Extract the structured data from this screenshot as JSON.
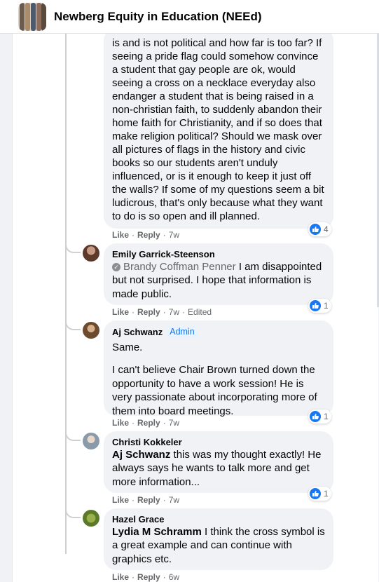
{
  "header": {
    "group_name": "Newberg Equity in Education (NEEd)"
  },
  "comments": [
    {
      "lines": [
        "is and is not political and how far is too far? If",
        "seeing a pride flag could somehow convince",
        "a student that gay people are ok, would",
        "seeing a cross on a necklace everyday also",
        "endanger a student that is being raised in a",
        "non-christian faith, to suddenly abandon their",
        "home faith for Christianity, and if so does that",
        "make religion political? Should we mask over",
        "all pictures of flags in the history and civic",
        "books so our students aren't unduly",
        "influenced, or is it enough to keep it just off",
        "the walls? If some of my questions seem a bit",
        "ludicrous, that's only because what they want",
        "to do is so open and ill planned."
      ],
      "like_label": "Like",
      "reply_label": "Reply",
      "time": "7w",
      "reaction_count": "4"
    },
    {
      "author": "Emily Garrick-Steenson",
      "mention": "Brandy Coffman Penner",
      "text_first": "I am disappointed",
      "text_rest": "but not surprised. I hope that information is made public.",
      "like_label": "Like",
      "reply_label": "Reply",
      "time": "7w",
      "edited": "Edited",
      "reaction_count": "1"
    },
    {
      "author": "Aj Schwanz",
      "badge": "Admin",
      "para1": "Same.",
      "para2": "I can't believe Chair Brown turned down the opportunity to have a work session! He is very passionate about incorporating more of them into board meetings.",
      "like_label": "Like",
      "reply_label": "Reply",
      "time": "7w",
      "reaction_count": "1"
    },
    {
      "author": "Christi Kokkeler",
      "mention": "Aj Schwanz",
      "text": "this was my thought exactly! He always says he wants to talk more and get more information...",
      "like_label": "Like",
      "reply_label": "Reply",
      "time": "7w",
      "reaction_count": "1"
    },
    {
      "author": "Hazel Grace",
      "mention": "Lydia M Schramm",
      "text": "I think the cross symbol is a great example and can continue with graphics etc.",
      "like_label": "Like",
      "reply_label": "Reply",
      "time": "6w"
    }
  ],
  "icons": {
    "like": "thumbs-up-icon",
    "verified": "verified-check-icon"
  },
  "colors": {
    "accent": "#1877f2",
    "bubble": "#f0f2f5",
    "meta": "#65676b"
  }
}
